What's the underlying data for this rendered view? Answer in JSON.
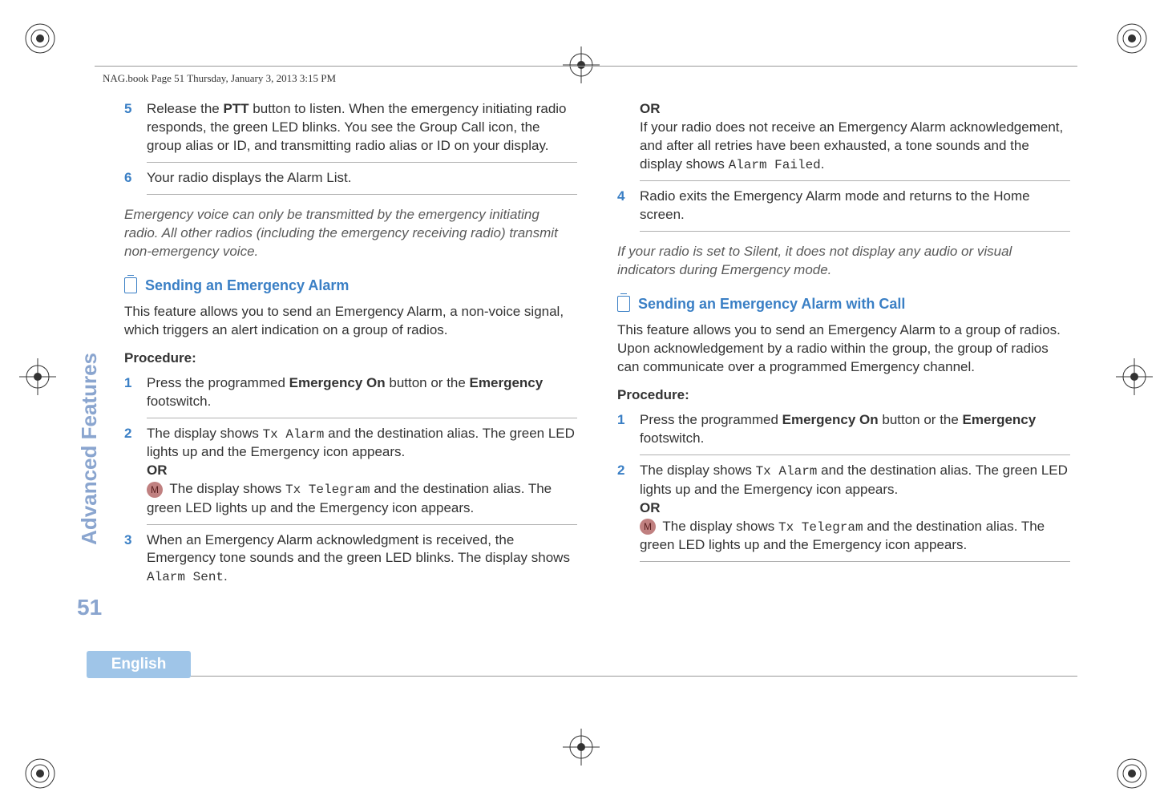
{
  "header": {
    "text": "NAG.book  Page 51  Thursday, January 3, 2013  3:15 PM"
  },
  "sidebar": {
    "tab": "Advanced Features",
    "page": "51",
    "language": "English"
  },
  "left": {
    "step5": {
      "num": "5",
      "body": "Release the <b>PTT</b> button to listen. When the emergency initiating radio responds, the green LED blinks. You see the Group Call icon, the group alias or ID, and transmitting radio alias or ID on your display."
    },
    "step6": {
      "num": "6",
      "body": "Your radio displays the Alarm List."
    },
    "note1": "Emergency voice can only be transmitted by the emergency initiating radio. All other radios (including the emergency receiving radio) transmit non-emergency voice.",
    "sectionA": {
      "title": "Sending an Emergency Alarm",
      "intro": "This feature allows you to send an Emergency Alarm, a non-voice signal, which triggers an alert indication on a group of radios.",
      "procLabel": "Procedure:",
      "s1": {
        "num": "1",
        "body": "Press the programmed <b>Emergency On</b> button or the <b>Emergency</b> footswitch."
      },
      "s2": {
        "num": "2",
        "line1_a": "The display shows ",
        "line1_code": "Tx Alarm",
        "line1_b": " and the destination alias. The green LED lights up and the Emergency icon appears.",
        "or": "OR",
        "line2_a": " The display shows ",
        "line2_code": "Tx Telegram",
        "line2_b": " and the destination alias. The green LED lights up and the Emergency icon appears."
      },
      "s3": {
        "num": "3",
        "body_a": "When an Emergency Alarm acknowledgment is received, the Emergency tone sounds and the green LED blinks. The display shows ",
        "code": "Alarm Sent",
        "body_b": "."
      }
    }
  },
  "right": {
    "top": {
      "or": "OR",
      "body_a": "If your radio does not receive an Emergency Alarm acknowledgement, and after all retries have been exhausted, a tone sounds and the display shows ",
      "code": "Alarm Failed",
      "body_b": "."
    },
    "step4": {
      "num": "4",
      "body": "Radio exits the Emergency Alarm mode and returns to the Home screen."
    },
    "note": "If your radio is set to Silent, it does not display any audio or visual indicators during Emergency mode.",
    "sectionB": {
      "title": "Sending an Emergency Alarm with Call",
      "intro": "This feature allows you to send an Emergency Alarm to a group of radios. Upon acknowledgement by a radio within the group, the group of radios can communicate over a programmed Emergency channel.",
      "procLabel": "Procedure:",
      "s1": {
        "num": "1",
        "body": "Press the programmed <b>Emergency On</b> button or the <b>Emergency</b> footswitch."
      },
      "s2": {
        "num": "2",
        "line1_a": "The display shows ",
        "line1_code": "Tx Alarm",
        "line1_b": " and the destination alias. The green LED lights up and the Emergency icon appears.",
        "or": "OR",
        "line2_a": " The display shows ",
        "line2_code": "Tx Telegram",
        "line2_b": " and the destination alias. The green LED lights up and the Emergency icon appears."
      }
    }
  },
  "icons": {
    "m": "M"
  }
}
